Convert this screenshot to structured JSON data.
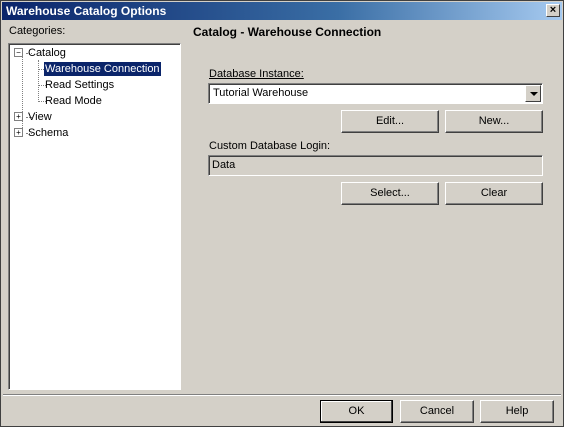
{
  "window": {
    "title": "Warehouse Catalog Options",
    "close_glyph": "×"
  },
  "categories": {
    "label": "Categories:",
    "tree": [
      {
        "label": "Catalog",
        "expander": "−"
      },
      {
        "label": "Warehouse Connection",
        "selected": true
      },
      {
        "label": "Read Settings"
      },
      {
        "label": "Read Mode"
      },
      {
        "label": "View",
        "expander": "+"
      },
      {
        "label": "Schema",
        "expander": "+"
      }
    ]
  },
  "panel": {
    "title": "Catalog - Warehouse Connection",
    "db_instance_label": "Database Instance:",
    "db_instance_value": "Tutorial Warehouse",
    "edit_button": "Edit...",
    "new_button": "New...",
    "login_label": "Custom Database Login:",
    "login_value": "Data",
    "select_button": "Select...",
    "clear_button": "Clear"
  },
  "footer": {
    "ok": "OK",
    "cancel": "Cancel",
    "help": "Help"
  },
  "colors": {
    "titlebar_start": "#0a246a",
    "titlebar_end": "#a6caf0",
    "dialog_bg": "#d4d0c8",
    "selection_bg": "#0a246a"
  }
}
